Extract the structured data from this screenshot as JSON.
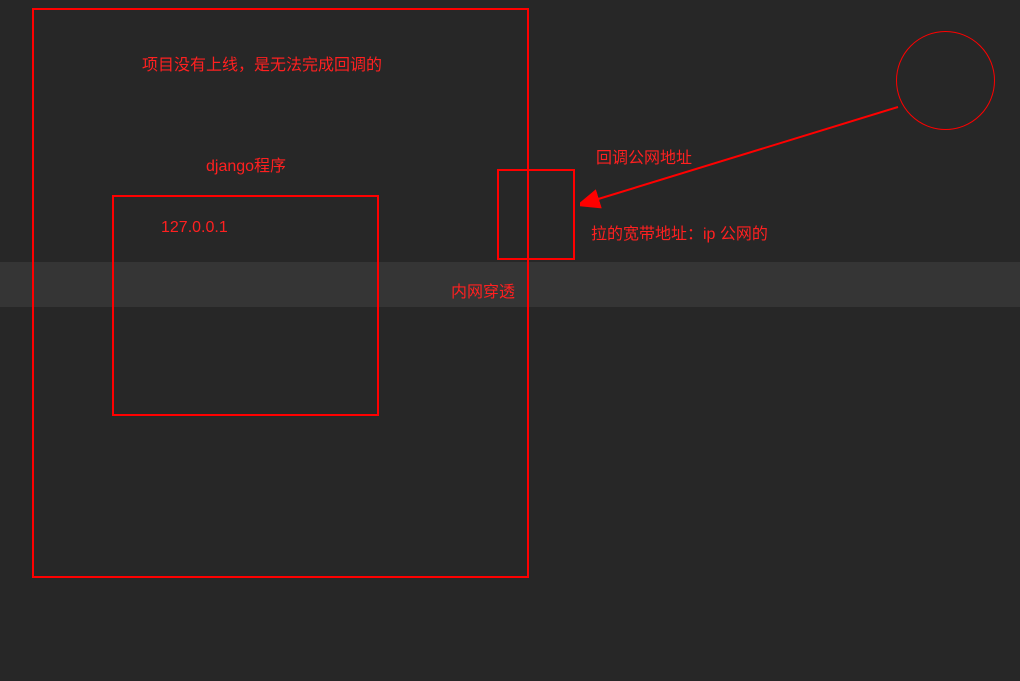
{
  "labels": {
    "title": "项目没有上线，是无法完成回调的",
    "django": "django程序",
    "localhost": "127.0.0.1",
    "callback": "回调公网地址",
    "penetration": "内网穿透",
    "broadband": "拉的宽带地址：ip 公网的"
  },
  "colors": {
    "background": "#272727",
    "highlight": "#353535",
    "stroke": "#ff0000",
    "text": "#ff2020"
  }
}
